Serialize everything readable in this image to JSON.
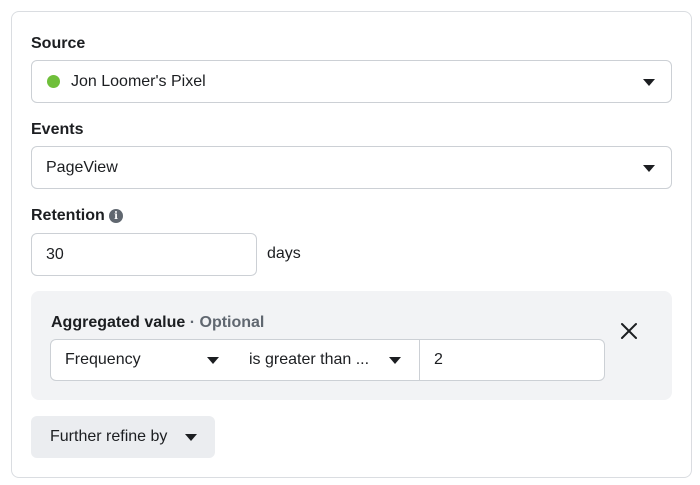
{
  "source": {
    "label": "Source",
    "value": "Jon Loomer's Pixel",
    "status_color": "#6fbf3a"
  },
  "events": {
    "label": "Events",
    "value": "PageView"
  },
  "retention": {
    "label": "Retention",
    "info_icon": "info-icon",
    "value": "30",
    "unit": "days"
  },
  "aggregated": {
    "label": "Aggregated value",
    "optional": "· Optional",
    "metric": "Frequency",
    "operator": "is greater than ...",
    "value": "2",
    "close_icon": "close-icon"
  },
  "refine": {
    "label": "Further refine by"
  }
}
